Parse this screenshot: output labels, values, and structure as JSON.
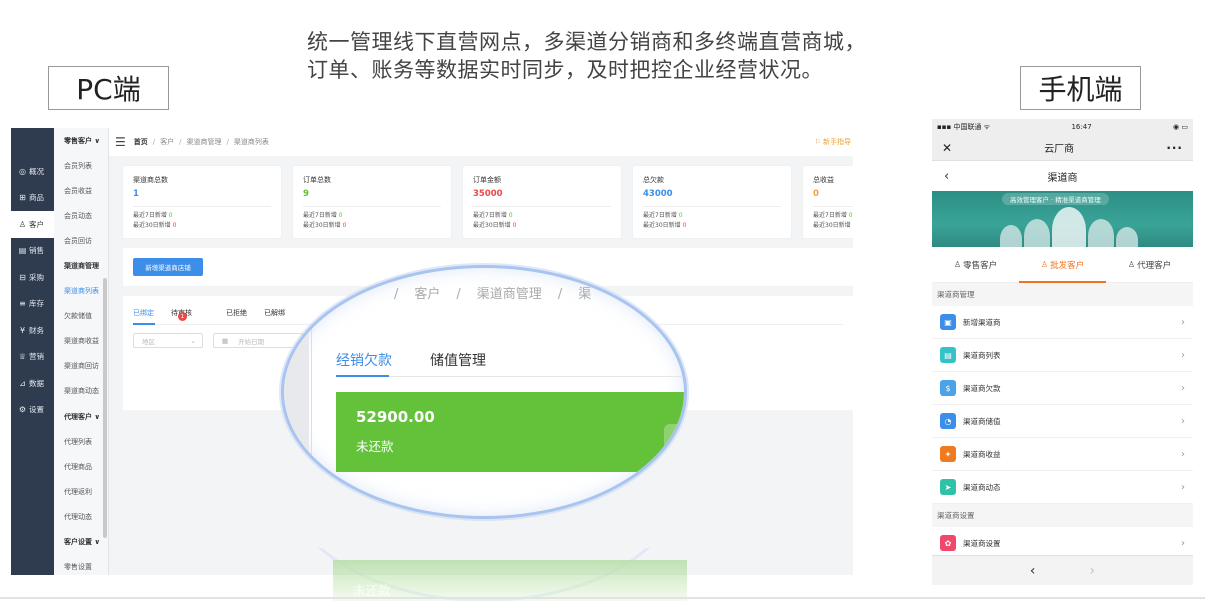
{
  "headline": {
    "line1": "统一管理线下直营网点，多渠道分销商和多终端直营商城，",
    "line2": "订单、账务等数据实时同步，及时把控企业经营状况。"
  },
  "labels": {
    "pc": "PC端",
    "mobile": "手机端"
  },
  "pc": {
    "nav": [
      {
        "icon": "◎",
        "label": "概况"
      },
      {
        "icon": "⊞",
        "label": "商品"
      },
      {
        "icon": "♙",
        "label": "客户"
      },
      {
        "icon": "▤",
        "label": "销售"
      },
      {
        "icon": "⊟",
        "label": "采购"
      },
      {
        "icon": "≡",
        "label": "库存"
      },
      {
        "icon": "¥",
        "label": "财务"
      },
      {
        "icon": "♕",
        "label": "营销"
      },
      {
        "icon": "⊿",
        "label": "数据"
      },
      {
        "icon": "⚙",
        "label": "设置"
      }
    ],
    "sub_menu": [
      {
        "label": "零售客户 ∨",
        "type": "head"
      },
      {
        "label": "会员列表",
        "type": "item"
      },
      {
        "label": "会员收益",
        "type": "item"
      },
      {
        "label": "会员动态",
        "type": "item"
      },
      {
        "label": "会员回访",
        "type": "item"
      },
      {
        "label": "渠道商管理",
        "type": "head"
      },
      {
        "label": "渠道商列表",
        "type": "on"
      },
      {
        "label": "欠款储值",
        "type": "item"
      },
      {
        "label": "渠道商收益",
        "type": "item"
      },
      {
        "label": "渠道商回访",
        "type": "item"
      },
      {
        "label": "渠道商动态",
        "type": "item"
      },
      {
        "label": "代理客户 ∨",
        "type": "head"
      },
      {
        "label": "代理列表",
        "type": "item"
      },
      {
        "label": "代理商品",
        "type": "item"
      },
      {
        "label": "代理返利",
        "type": "item"
      },
      {
        "label": "代理动态",
        "type": "item"
      },
      {
        "label": "客户设置 ∨",
        "type": "head"
      },
      {
        "label": "零售设置",
        "type": "item"
      }
    ],
    "breadcrumb": [
      "首页",
      "客户",
      "渠道商管理",
      "渠道商列表"
    ],
    "guide": "⚐ 新手指导",
    "stats": [
      {
        "title": "渠道商总数",
        "value": "1",
        "color": "#3c8ee8",
        "r7": "最近7日新增",
        "v7": "0",
        "r30": "最近30日新增",
        "v30": "0"
      },
      {
        "title": "订单总数",
        "value": "9",
        "color": "#5fbf34",
        "r7": "最近7日新增",
        "v7": "0",
        "r30": "最近30日新增",
        "v30": "0"
      },
      {
        "title": "订单金额",
        "value": "35000",
        "color": "#e64a4a",
        "r7": "最近7日新增",
        "v7": "0",
        "r30": "最近30日新增",
        "v30": "0"
      },
      {
        "title": "总欠款",
        "value": "43000",
        "color": "#3c8ee8",
        "r7": "最近7日新增",
        "v7": "0",
        "r30": "最近30日新增",
        "v30": "0"
      },
      {
        "title": "总收益",
        "value": "0",
        "color": "#e8a33c",
        "r7": "最近7日新增",
        "v7": "0",
        "r30": "最近30日新增",
        "v30": "0"
      }
    ],
    "add_button": "新增渠道商店铺",
    "list_tabs": [
      "已绑定",
      "待审核",
      "已拒绝",
      "已解绑"
    ],
    "pending_badge": "1",
    "filter_region": "地区",
    "filter_date": "开始日期"
  },
  "magnifier": {
    "crumb": [
      "/",
      "客户",
      "/",
      "渠道商管理",
      "/",
      "渠"
    ],
    "tabs": [
      "经销欠款",
      "储值管理"
    ],
    "amount": "52900.00",
    "amount_label": "未还款"
  },
  "mobile": {
    "status_left": "▪▪▪ 中国联通 ᯤ",
    "status_time": "16:47",
    "status_right": "◉ ▭",
    "app_title": "云厂商",
    "page_title": "渠道商",
    "banner_slogan": "高效管理客户 · 精准渠道商管理",
    "tabs": [
      {
        "label": "零售客户",
        "on": false
      },
      {
        "label": "批发客户",
        "on": true
      },
      {
        "label": "代理客户",
        "on": false
      }
    ],
    "section1": "渠道商管理",
    "items": [
      {
        "label": "新增渠道商",
        "color": "#3c8ee8",
        "icon": "▣"
      },
      {
        "label": "渠道商列表",
        "color": "#35c1c8",
        "icon": "▤"
      },
      {
        "label": "渠道商欠款",
        "color": "#4aa3e8",
        "icon": "$"
      },
      {
        "label": "渠道商储值",
        "color": "#3c8ee8",
        "icon": "◔"
      },
      {
        "label": "渠道商收益",
        "color": "#f07a1f",
        "icon": "✦"
      },
      {
        "label": "渠道商动态",
        "color": "#2fc2a8",
        "icon": "➤"
      }
    ],
    "section2": "渠道商设置",
    "settings_item": {
      "label": "渠道商设置",
      "color": "#f0476b",
      "icon": "✿"
    }
  }
}
